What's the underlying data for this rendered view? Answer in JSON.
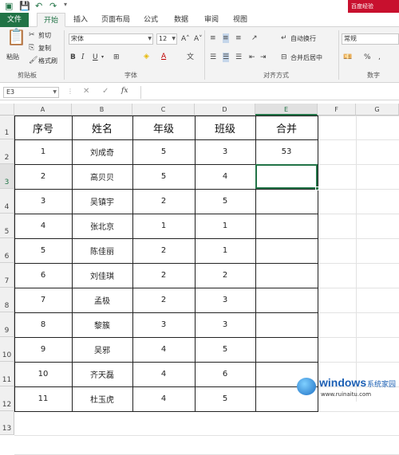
{
  "titlebar": {
    "right_text": "百度经验"
  },
  "tabs": [
    {
      "label": "文件"
    },
    {
      "label": "开始"
    },
    {
      "label": "插入"
    },
    {
      "label": "页面布局"
    },
    {
      "label": "公式"
    },
    {
      "label": "数据"
    },
    {
      "label": "审阅"
    },
    {
      "label": "视图"
    }
  ],
  "ribbon": {
    "clipboard": {
      "paste": "粘贴",
      "cut": "剪切",
      "copy": "复制",
      "format_painter": "格式刷",
      "group": "剪贴板"
    },
    "font": {
      "name": "宋体",
      "size": "12",
      "group": "字体"
    },
    "alignment": {
      "wrap": "自动换行",
      "merge": "合并后居中",
      "group": "对齐方式"
    },
    "number": {
      "format": "常规",
      "percent": "%",
      "comma": ",",
      "group": "数字"
    }
  },
  "formula_bar": {
    "name_box": "E3",
    "fx": "fx",
    "content": ""
  },
  "columns": [
    "A",
    "B",
    "C",
    "D",
    "E",
    "F",
    "G"
  ],
  "rows": [
    "1",
    "2",
    "3",
    "4",
    "5",
    "6",
    "7",
    "8",
    "9",
    "10",
    "11",
    "12",
    "13"
  ],
  "table": {
    "headers": [
      "序号",
      "姓名",
      "年级",
      "班级",
      "合并"
    ],
    "rows": [
      [
        "1",
        "刘成奇",
        "5",
        "3",
        "53"
      ],
      [
        "2",
        "高贝贝",
        "5",
        "4",
        ""
      ],
      [
        "3",
        "吴镇宇",
        "2",
        "5",
        ""
      ],
      [
        "4",
        "张北京",
        "1",
        "1",
        ""
      ],
      [
        "5",
        "陈佳丽",
        "2",
        "1",
        ""
      ],
      [
        "6",
        "刘佳琪",
        "2",
        "2",
        ""
      ],
      [
        "7",
        "孟极",
        "2",
        "3",
        ""
      ],
      [
        "8",
        "黎簇",
        "3",
        "3",
        ""
      ],
      [
        "9",
        "吴邪",
        "4",
        "5",
        ""
      ],
      [
        "10",
        "齐天磊",
        "4",
        "6",
        ""
      ],
      [
        "11",
        "杜玉虎",
        "4",
        "5",
        ""
      ]
    ]
  },
  "watermark": {
    "brand": "windows",
    "suffix": "系统家园",
    "url": "www.ruinaitu.com"
  },
  "colors": {
    "excel_green": "#217346",
    "title_red": "#c8102e"
  }
}
